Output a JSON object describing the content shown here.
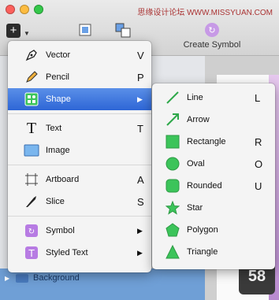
{
  "watermark": "思缘设计论坛 WWW.MISSYUAN.COM",
  "toolbar": {
    "insert_glyph": "+",
    "create_symbol_label": "Create Symbol"
  },
  "insert_menu": {
    "items": [
      {
        "label": "Vector",
        "shortcut": "V",
        "icon": "pen-icon"
      },
      {
        "label": "Pencil",
        "shortcut": "P",
        "icon": "pencil-icon"
      },
      {
        "label": "Shape",
        "shortcut": "▶",
        "icon": "shape-icon",
        "selected": true
      },
      {
        "label": "Text",
        "shortcut": "T",
        "icon": "text-icon"
      },
      {
        "label": "Image",
        "shortcut": "",
        "icon": "image-icon"
      },
      {
        "label": "Artboard",
        "shortcut": "A",
        "icon": "artboard-icon"
      },
      {
        "label": "Slice",
        "shortcut": "S",
        "icon": "slice-icon"
      },
      {
        "label": "Symbol",
        "shortcut": "▶",
        "icon": "symbol-icon"
      },
      {
        "label": "Styled Text",
        "shortcut": "▶",
        "icon": "styled-text-icon"
      }
    ]
  },
  "shape_submenu": {
    "items": [
      {
        "label": "Line",
        "shortcut": "L"
      },
      {
        "label": "Arrow",
        "shortcut": ""
      },
      {
        "label": "Rectangle",
        "shortcut": "R"
      },
      {
        "label": "Oval",
        "shortcut": "O"
      },
      {
        "label": "Rounded",
        "shortcut": "U"
      },
      {
        "label": "Star",
        "shortcut": ""
      },
      {
        "label": "Polygon",
        "shortcut": ""
      },
      {
        "label": "Triangle",
        "shortcut": ""
      }
    ]
  },
  "layers": {
    "background_label": "Background"
  },
  "badge": "58",
  "colors": {
    "selection": "#2e66d6",
    "shape_green": "#3cc45a",
    "symbol_purple": "#a460d8"
  }
}
